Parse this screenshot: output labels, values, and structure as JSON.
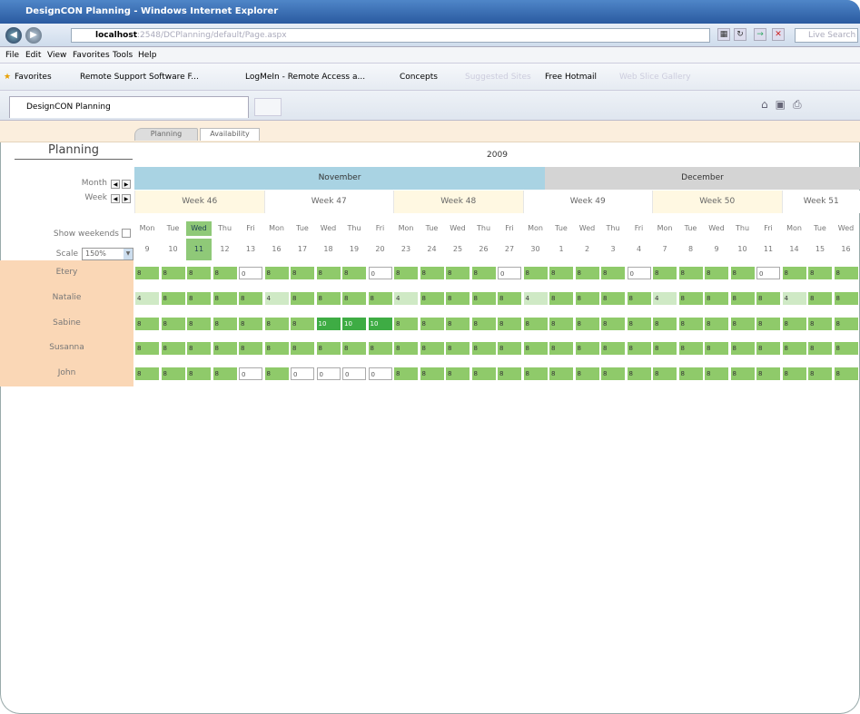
{
  "browser": {
    "window_title": "DesignCON Planning - Windows Internet Explorer",
    "address": "localhost",
    "address_rest": ":2548/DCPlanning/default/Page.aspx",
    "search_placeholder": "Live Search",
    "menu": [
      "File",
      "Edit",
      "View",
      "Favorites",
      "Tools",
      "Help"
    ],
    "favorites": [
      "Favorites",
      "Remote Support Software F...",
      "LogMeIn - Remote Access a...",
      "Concepts",
      "Suggested Sites",
      "Free Hotmail",
      "Web Slice Gallery"
    ],
    "tab_title": "DesignCON Planning"
  },
  "app": {
    "tabs": [
      "Planning",
      "Availability"
    ],
    "title": "Planning",
    "year": "2009",
    "months": [
      "November",
      "December"
    ],
    "controls": {
      "month_label": "Month",
      "week_label": "Week",
      "show_weekends_label": "Show weekends",
      "scale_label": "Scale",
      "scale_value": "150%"
    },
    "weeks": [
      "Week 46",
      "Week 47",
      "Week 48",
      "Week 49",
      "Week 50",
      "Week 51"
    ],
    "day_names": [
      "Mon",
      "Tue",
      "Wed",
      "Thu",
      "Fri"
    ],
    "day_numbers": [
      "9",
      "10",
      "11",
      "12",
      "13",
      "16",
      "17",
      "18",
      "19",
      "20",
      "23",
      "24",
      "25",
      "26",
      "27",
      "30",
      "1",
      "2",
      "3",
      "4",
      "7",
      "8",
      "9",
      "10",
      "11",
      "14",
      "15",
      "16"
    ],
    "today_index": 2,
    "people": [
      {
        "name": "Etery",
        "hours": [
          "8",
          "8",
          "8",
          "8",
          "0",
          "8",
          "8",
          "8",
          "8",
          "0",
          "8",
          "8",
          "8",
          "8",
          "0",
          "8",
          "8",
          "8",
          "8",
          "0",
          "8",
          "8",
          "8",
          "8",
          "0",
          "8",
          "8",
          "8"
        ]
      },
      {
        "name": "Natalie",
        "hours": [
          "4",
          "8",
          "8",
          "8",
          "8",
          "4",
          "8",
          "8",
          "8",
          "8",
          "4",
          "8",
          "8",
          "8",
          "8",
          "4",
          "8",
          "8",
          "8",
          "8",
          "4",
          "8",
          "8",
          "8",
          "8",
          "4",
          "8",
          "8"
        ]
      },
      {
        "name": "Sabine",
        "hours": [
          "8",
          "8",
          "8",
          "8",
          "8",
          "8",
          "8",
          "10",
          "10",
          "10",
          "8",
          "8",
          "8",
          "8",
          "8",
          "8",
          "8",
          "8",
          "8",
          "8",
          "8",
          "8",
          "8",
          "8",
          "8",
          "8",
          "8",
          "8"
        ]
      },
      {
        "name": "Susanna",
        "hours": [
          "8",
          "8",
          "8",
          "8",
          "8",
          "8",
          "8",
          "8",
          "8",
          "8",
          "8",
          "8",
          "8",
          "8",
          "8",
          "8",
          "8",
          "8",
          "8",
          "8",
          "8",
          "8",
          "8",
          "8",
          "8",
          "8",
          "8",
          "8"
        ]
      },
      {
        "name": "John",
        "hours": [
          "8",
          "8",
          "8",
          "8",
          "0",
          "8",
          "0",
          "0",
          "0",
          "0",
          "8",
          "8",
          "8",
          "8",
          "8",
          "8",
          "8",
          "8",
          "8",
          "8",
          "8",
          "8",
          "8",
          "8",
          "8",
          "8",
          "8",
          "8"
        ]
      }
    ]
  }
}
